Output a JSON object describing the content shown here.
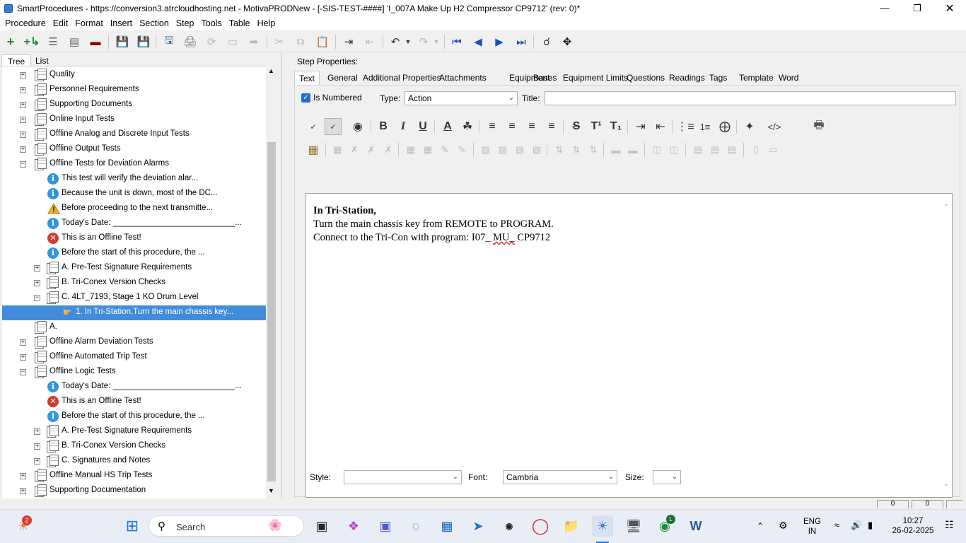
{
  "window": {
    "title": "SmartProcedures - https://conversion3.atrcloudhosting.net - MotivaPRODNew - [-SIS-TEST-####] 'I_007A Make Up H2 Compressor CP9712' (rev: 0)*"
  },
  "menu": [
    "Procedure",
    "Edit",
    "Format",
    "Insert",
    "Section",
    "Step",
    "Tools",
    "Table",
    "Help"
  ],
  "left_tabs": [
    "Tree",
    "List"
  ],
  "tree": [
    {
      "label": "Quality",
      "icon": "doc-icon",
      "expander": "+"
    },
    {
      "label": "Personnel Requirements",
      "icon": "doc-icon",
      "expander": "+"
    },
    {
      "label": "Supporting Documents",
      "icon": "doc-icon",
      "expander": "+"
    },
    {
      "label": "Online Input Tests",
      "icon": "doc-icon",
      "expander": "+"
    },
    {
      "label": "Offline Analog and Discrete Input Tests",
      "icon": "doc-icon",
      "expander": "+"
    },
    {
      "label": "Offline Output Tests",
      "icon": "doc-icon",
      "expander": "+"
    },
    {
      "label": "Offline Tests for Deviation Alarms",
      "icon": "doc-icon",
      "expander": "−"
    },
    {
      "label": "This test will verify the deviation alar...",
      "icon": "info-icon"
    },
    {
      "label": "Because the unit is down, most of the DC...",
      "icon": "info-icon"
    },
    {
      "label": "Before proceeding to the next transmitte...",
      "icon": "warning-icon"
    },
    {
      "label": "Today's Date: ___________________________...",
      "icon": "info-icon"
    },
    {
      "label": "This is an Offline Test!",
      "icon": "error-icon"
    },
    {
      "label": "Before the start of this procedure, the ...",
      "icon": "info-icon"
    },
    {
      "label": "A. Pre-Test Signature Requirements",
      "icon": "doc-icon",
      "expander": "+"
    },
    {
      "label": "B. Tri-Conex Version Checks",
      "icon": "doc-icon",
      "expander": "+"
    },
    {
      "label": "C. 4LT_7193, Stage 1 KO Drum Level",
      "icon": "doc-icon",
      "expander": "−"
    },
    {
      "label": "1. In Tri-Station,Turn the main chassis key...",
      "icon": "hand-icon",
      "selected": true
    },
    {
      "label": "A.",
      "icon": "doc-icon"
    },
    {
      "label": "Offline Alarm Deviation Tests",
      "icon": "doc-icon",
      "expander": "+"
    },
    {
      "label": "Offline Automated Trip Test",
      "icon": "doc-icon",
      "expander": "+"
    },
    {
      "label": "Offline Logic Tests",
      "icon": "doc-icon",
      "expander": "−"
    },
    {
      "label": "Today's Date: ___________________________...",
      "icon": "info-icon"
    },
    {
      "label": "This is an Offline Test!",
      "icon": "error-icon"
    },
    {
      "label": "Before the start of this procedure, the ...",
      "icon": "info-icon"
    },
    {
      "label": "A. Pre-Test Signature Requirements",
      "icon": "doc-icon",
      "expander": "+"
    },
    {
      "label": "B. Tri-Conex Version Checks",
      "icon": "doc-icon",
      "expander": "+"
    },
    {
      "label": "C. Signatures and Notes",
      "icon": "doc-icon",
      "expander": "+"
    },
    {
      "label": "Offline Manual HS Trip Tests",
      "icon": "doc-icon",
      "expander": "+"
    },
    {
      "label": "Supporting Documentation",
      "icon": "doc-icon",
      "expander": "+"
    }
  ],
  "step_properties": {
    "heading": "Step Properties:",
    "tabs": [
      "Text",
      "General",
      "Additional Properties",
      "Attachments",
      "Equipment",
      "Bases",
      "Equipment Limits",
      "Questions",
      "Readings",
      "Tags",
      "Template",
      "Word"
    ],
    "is_numbered_label": "Is Numbered",
    "type_label": "Type:",
    "type_value": "Action",
    "title_label": "Title:",
    "title_value": ""
  },
  "editor": {
    "line1_bold": "In Tri-Station",
    "line1_rest": ",",
    "line2": "Turn the main chassis key from REMOTE to PROGRAM.",
    "line3_a": "Connect to the Tri-Con with program: I07_ ",
    "line3_b": "MU_",
    "line3_c": " CP9712"
  },
  "footer": {
    "style_label": "Style:",
    "style_value": "",
    "font_label": "Font:",
    "font_value": "Cambria",
    "size_label": "Size:",
    "size_value": ""
  },
  "status": {
    "box1": "0",
    "box2": "0"
  },
  "taskbar": {
    "notification_count": "2",
    "search_label": "Search",
    "lang_line1": "ENG",
    "lang_line2": "IN",
    "time": "10:27",
    "date": "26-02-2025",
    "chrome_badge": "L"
  },
  "colors": {
    "selection": "#3f8ddb",
    "info": "#2f96e0",
    "error": "#d43a2f",
    "accent": "#1e6fd0"
  }
}
